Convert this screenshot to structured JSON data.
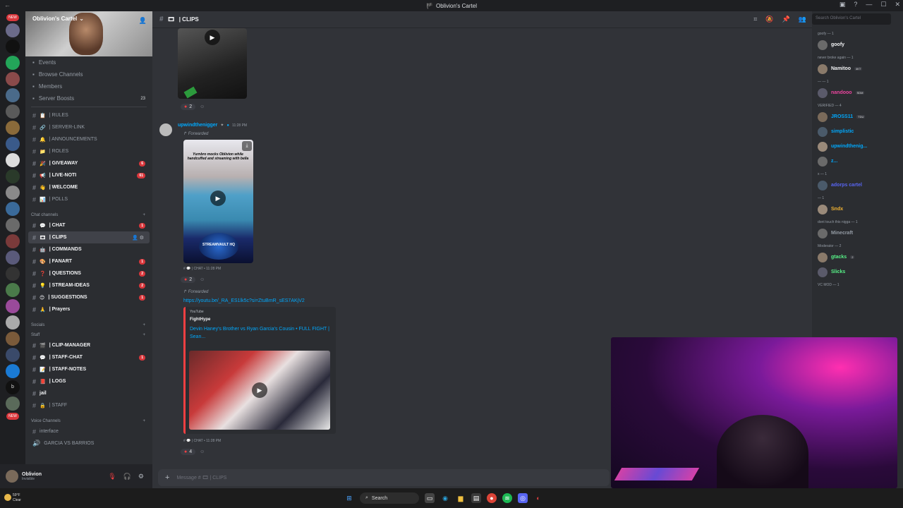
{
  "window": {
    "title": "Oblivion's Cartel"
  },
  "servers": {
    "new_badge": "NEW",
    "bottom_new_badge": "NEW",
    "letter": "b"
  },
  "server": {
    "name": "Oblivion's Cartel"
  },
  "sidebar": {
    "menu": [
      {
        "label": "Events",
        "icon": "calendar-icon"
      },
      {
        "label": "Browse Channels",
        "icon": "browse-icon"
      },
      {
        "label": "Members",
        "icon": "members-icon"
      },
      {
        "label": "Server Boosts",
        "icon": "boost-icon",
        "count": "23"
      }
    ],
    "channels_top": [
      {
        "emoji": "📋",
        "name": "| RULES",
        "bold": false,
        "badge": ""
      },
      {
        "emoji": "🔗",
        "name": "| SERVER-LINK",
        "bold": false,
        "badge": ""
      },
      {
        "emoji": "🔔",
        "name": "| ANNOUNCEMENTS",
        "bold": false,
        "badge": ""
      },
      {
        "emoji": "📁",
        "name": "| ROLES",
        "bold": false,
        "badge": ""
      },
      {
        "emoji": "🎉",
        "name": "| GIVEAWAY",
        "bold": true,
        "badge": "6"
      },
      {
        "emoji": "📢",
        "name": "| LIVE-NOTI",
        "bold": true,
        "badge": "61"
      },
      {
        "emoji": "👋",
        "name": "| WELCOME",
        "bold": true,
        "badge": ""
      },
      {
        "emoji": "📊",
        "name": "| POLLS",
        "bold": false,
        "badge": ""
      }
    ],
    "chat_category": "Chat channels",
    "chat_channels": [
      {
        "emoji": "💬",
        "name": "| CHAT",
        "bold": true,
        "badge": "1"
      },
      {
        "emoji": "🎞",
        "name": "| CLIPS",
        "bold": true,
        "badge": "",
        "active": true
      },
      {
        "emoji": "🤖",
        "name": "| COMMANDS",
        "bold": true,
        "badge": ""
      },
      {
        "emoji": "🎨",
        "name": "| FANART",
        "bold": true,
        "badge": "1"
      },
      {
        "emoji": "❓",
        "name": "| QUESTIONS",
        "bold": true,
        "badge": "2"
      },
      {
        "emoji": "💡",
        "name": "| STREAM-IDEAS",
        "bold": true,
        "badge": "2"
      },
      {
        "emoji": "😊",
        "name": "| SUGGESTIONS",
        "bold": true,
        "badge": "1"
      },
      {
        "emoji": "🙏",
        "name": "| Prayers",
        "bold": true,
        "badge": ""
      }
    ],
    "socials_category": "Socials",
    "staff_category": "Staff",
    "staff_channels": [
      {
        "emoji": "🎬",
        "name": "| CLIP-MANAGER",
        "bold": true,
        "badge": ""
      },
      {
        "emoji": "💬",
        "name": "| STAFF-CHAT",
        "bold": true,
        "badge": "1"
      },
      {
        "emoji": "📝",
        "name": "| STAFF-NOTES",
        "bold": true,
        "badge": ""
      },
      {
        "emoji": "📕",
        "name": "| LOGS",
        "bold": true,
        "badge": ""
      },
      {
        "emoji": "",
        "name": "jail",
        "bold": true,
        "badge": ""
      },
      {
        "emoji": "🔒",
        "name": "| STAFF",
        "bold": false,
        "badge": ""
      }
    ],
    "voice_category": "Voice Channels",
    "voice_channels": [
      {
        "name": "interface"
      },
      {
        "name": "GARCIA VS BARRIOS"
      }
    ]
  },
  "userbar": {
    "name": "Oblivion",
    "status": "Invisible"
  },
  "channel": {
    "header": "| CLIPS"
  },
  "messages": {
    "first_reaction_count": "2",
    "post2": {
      "author": "upwindthenigger",
      "time": "11:28 PM",
      "forwarded_label": "Forwarded",
      "thumb_caption": "Yurnbro mocks Oblivion while handcuffed and streaming with bella",
      "thumb_logo": "STREAMVAULT HQ",
      "source": "# 💬 | CHAT • 11:28 PM",
      "reaction_count": "2"
    },
    "post3": {
      "forwarded_label": "Forwarded",
      "link": "https://youtu.be/_RA_ES1lk5c?si=ZtuBmR_sES7AKjV2",
      "provider": "YouTube",
      "embed_author": "FightHype",
      "embed_title": "Devin Haney's Brother vs Ryan Garcia's Cousin • FULL FIGHT | Sean...",
      "source": "# 💬 | CHAT • 11:28 PM",
      "reaction_count": "4"
    }
  },
  "composer": {
    "placeholder": "Message # 🎞 | CLIPS"
  },
  "search": {
    "placeholder": "Search Oblivion's Cartel"
  },
  "members": [
    {
      "group": "goofy — 1",
      "items": [
        {
          "name": "goofy",
          "color": "#f2f3f5",
          "tag": ""
        }
      ]
    },
    {
      "group": "never broke again — 1",
      "items": [
        {
          "name": "Namitoo",
          "color": "#f2f3f5",
          "tag": "4KT"
        }
      ]
    },
    {
      "group": "— — 1",
      "items": [
        {
          "name": "nandooo",
          "color": "#eb459e",
          "tag": "SDM"
        }
      ]
    },
    {
      "group": "VERIFIED — 4",
      "items": [
        {
          "name": "JROSS11",
          "color": "#00a8fc",
          "tag": "TDU"
        },
        {
          "name": "simplistic",
          "color": "#00a8fc",
          "tag": ""
        },
        {
          "name": "upwindthenig...",
          "color": "#00a8fc",
          "tag": ""
        },
        {
          "name": "z...",
          "color": "#00a8fc",
          "tag": ""
        }
      ]
    },
    {
      "group": "x — 1",
      "items": [
        {
          "name": "adorps cartel",
          "color": "#5865f2",
          "tag": ""
        }
      ]
    },
    {
      "group": "— 1",
      "items": [
        {
          "name": "Sndx",
          "color": "#f0b232",
          "tag": ""
        }
      ]
    },
    {
      "group": "dont touch this nigga — 1",
      "items": [
        {
          "name": "Minecraft",
          "color": "#949ba4",
          "tag": ""
        }
      ]
    },
    {
      "group": "Moderator — 2",
      "items": [
        {
          "name": "gtacks",
          "color": "#57f287",
          "tag": "2"
        },
        {
          "name": "Slicks",
          "color": "#57f287",
          "tag": ""
        }
      ]
    },
    {
      "group": "VC MOD — 1",
      "items": []
    }
  ],
  "taskbar": {
    "weather_temp": "59°F",
    "weather_desc": "Clear",
    "search_label": "Search"
  }
}
